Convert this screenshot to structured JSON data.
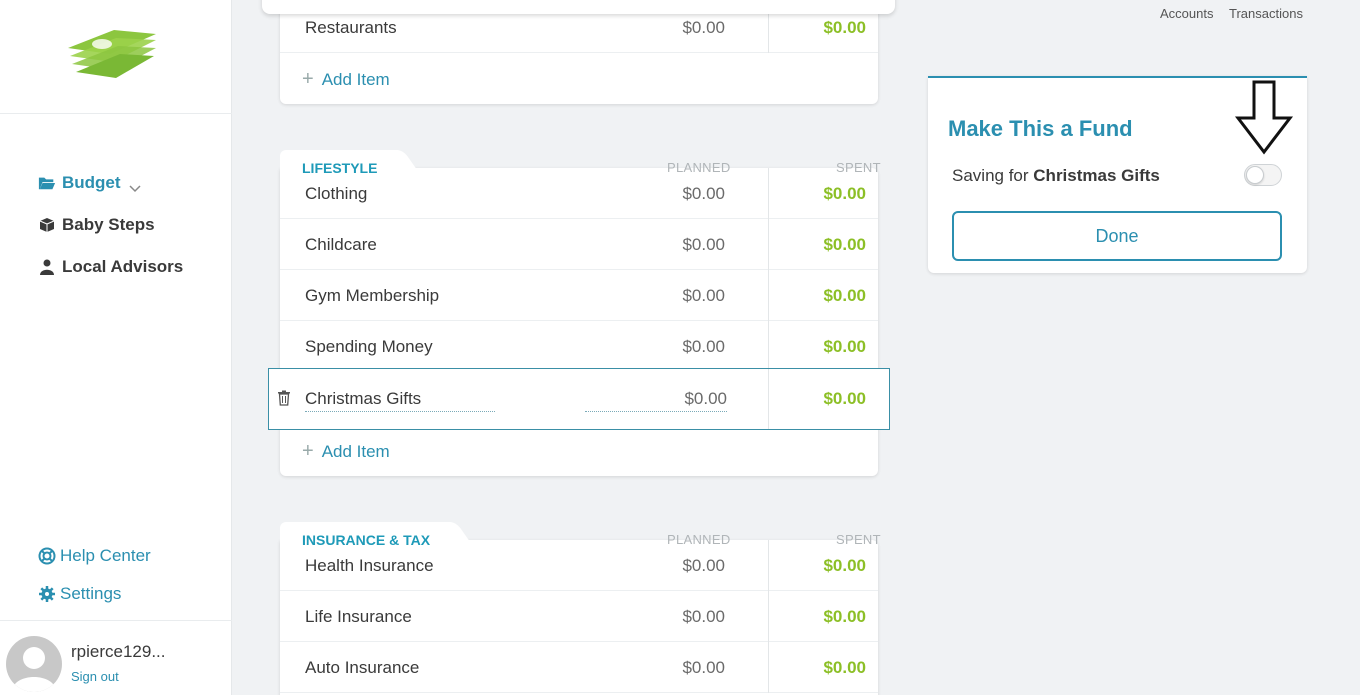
{
  "sidebar": {
    "nav": {
      "budget": "Budget",
      "baby_steps": "Baby Steps",
      "local_advisors": "Local Advisors"
    },
    "footer": {
      "help": "Help Center",
      "settings": "Settings"
    },
    "user": {
      "name": "rpierce129...",
      "sign_out": "Sign out"
    }
  },
  "header": {
    "accounts": "Accounts",
    "transactions": "Transactions"
  },
  "colors": {
    "accent": "#2b8fb0",
    "spent": "#8cbf26",
    "section": "#1e9ab8"
  },
  "food": {
    "rows": [
      {
        "label": "Restaurants",
        "planned": "$0.00",
        "spent": "$0.00"
      }
    ],
    "add_item": "Add Item"
  },
  "lifestyle": {
    "title": "LIFESTYLE",
    "planned_head": "PLANNED",
    "spent_head": "SPENT",
    "rows": [
      {
        "label": "Clothing",
        "planned": "$0.00",
        "spent": "$0.00"
      },
      {
        "label": "Childcare",
        "planned": "$0.00",
        "spent": "$0.00"
      },
      {
        "label": "Gym Membership",
        "planned": "$0.00",
        "spent": "$0.00"
      },
      {
        "label": "Spending Money",
        "planned": "$0.00",
        "spent": "$0.00"
      }
    ],
    "editing_row": {
      "label": "Christmas Gifts",
      "planned": "$0.00",
      "spent": "$0.00"
    },
    "add_item": "Add Item"
  },
  "insurance": {
    "title": "INSURANCE & TAX",
    "planned_head": "PLANNED",
    "spent_head": "SPENT",
    "rows": [
      {
        "label": "Health Insurance",
        "planned": "$0.00",
        "spent": "$0.00"
      },
      {
        "label": "Life Insurance",
        "planned": "$0.00",
        "spent": "$0.00"
      },
      {
        "label": "Auto Insurance",
        "planned": "$0.00",
        "spent": "$0.00"
      }
    ]
  },
  "fund_panel": {
    "title": "Make This a Fund",
    "saving_prefix": "Saving for",
    "saving_item": "Christmas Gifts",
    "toggle_on": false,
    "done": "Done"
  }
}
